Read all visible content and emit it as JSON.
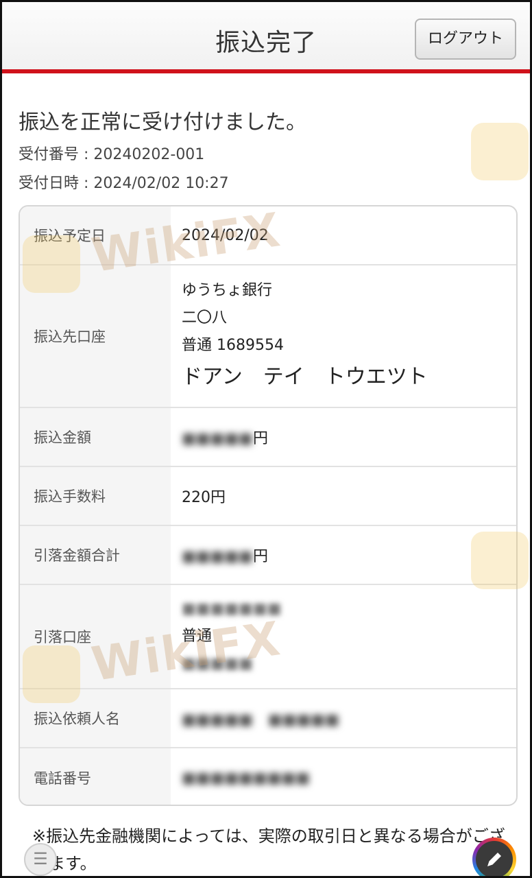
{
  "header": {
    "title": "振込完了",
    "logout_label": "ログアウト"
  },
  "lead": "振込を正常に受け付けました。",
  "receipt": {
    "number_line": "受付番号 : 20240202-001",
    "datetime_line": "受付日時 : 2024/02/02 10:27"
  },
  "details": {
    "scheduled_date": {
      "label": "振込予定日",
      "value": "2024/02/02"
    },
    "destination": {
      "label": "振込先口座",
      "bank": "ゆうちょ銀行",
      "branch": "二〇八",
      "account": "普通 1689554",
      "holder": "ドアン　テイ　トウエツト"
    },
    "amount": {
      "label": "振込金額",
      "value": "円"
    },
    "fee": {
      "label": "振込手数料",
      "value": "220円"
    },
    "total": {
      "label": "引落金額合計",
      "value": "円"
    },
    "debit_account": {
      "label": "引落口座",
      "type": "普通"
    },
    "requester": {
      "label": "振込依頼人名"
    },
    "phone": {
      "label": "電話番号"
    }
  },
  "note": "※振込先金融機関によっては、実際の取引日と異なる場合がございます。",
  "watermark": {
    "text": "WikiFX"
  },
  "colors": {
    "accent": "#d0121b"
  }
}
